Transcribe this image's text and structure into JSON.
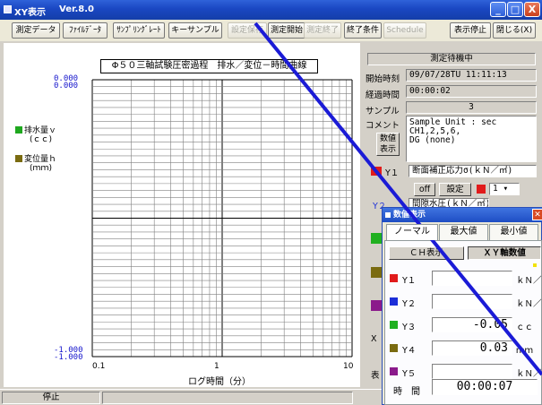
{
  "window": {
    "title": "XY表示",
    "version": "Ver.8.0",
    "btn_min": "_",
    "btn_max": "□",
    "btn_close": "X"
  },
  "toolbar": {
    "items": [
      {
        "label": "測定データ",
        "enabled": true
      },
      {
        "label": "ﾌｧｲﾙﾃﾞｰﾀ",
        "enabled": true
      },
      {
        "label": "ｻﾝﾌﾟﾘﾝｸﾞﾚｰﾄ",
        "enabled": true
      },
      {
        "label": "キーサンプル",
        "enabled": true
      },
      {
        "label": "設定保存",
        "enabled": false
      },
      {
        "label": "測定開始",
        "enabled": true
      },
      {
        "label": "測定終了",
        "enabled": false
      },
      {
        "label": "終了条件",
        "enabled": true
      },
      {
        "label": "Schedule",
        "enabled": false
      },
      {
        "label": "表示停止",
        "enabled": true
      },
      {
        "label": "閉じる(X)",
        "enabled": true
      }
    ]
  },
  "chart_data": {
    "type": "line",
    "title": "Φ５０三軸試験圧密過程　排水／変位－時間曲線",
    "xlabel": "ログ時間（分）",
    "x_scale": "log",
    "xlim": [
      0.1,
      10
    ],
    "x_tick_labels": [
      "0.1",
      "1",
      "10"
    ],
    "y_top_labels": [
      "0.000",
      "0.000"
    ],
    "y_bottom_labels": [
      "-1.000",
      "-1.000"
    ],
    "ylim": [
      -1,
      0
    ],
    "grid": true,
    "series": [
      {
        "name": "排水量ｖ",
        "unit": "(ｃｃ)",
        "color": "#1fa81f",
        "values": []
      },
      {
        "name": "変位量ｈ",
        "unit": "(ｍｍ)",
        "color": "#7a6b10",
        "values": []
      }
    ]
  },
  "panel": {
    "status": "測定待機中",
    "start_time_label": "開始時刻",
    "start_time": "09/07/28TU 11:11:13",
    "elapsed_label": "経過時間",
    "elapsed": "00:00:02",
    "sample_label": "サンプル",
    "sample": "3",
    "comment_label": "コメント",
    "comment_lines": [
      "Sample Unit : sec",
      "CH1,2,5,6,",
      "DG (none)"
    ],
    "numeric_button": "数値表示",
    "y1_label": "Y１",
    "y1_field": "断面補正応力σ(ｋＮ／㎡)",
    "off_button": "off",
    "settings_button": "設定",
    "y2_fragment": "Y２",
    "y2_fragment_text": "間隙水圧(ｋＮ／㎡)",
    "x_fragment": "X",
    "hyo_fragment": "表"
  },
  "popup": {
    "title": "数値表示",
    "tabs": [
      "ノーマル",
      "最大値",
      "最小値"
    ],
    "subtabs": [
      "ＣＨ表示",
      "ＸＹ軸数値"
    ],
    "rows": [
      {
        "label": "Y１",
        "value": "",
        "unit": "ｋＮ／ｍ",
        "color": "#e11b1b"
      },
      {
        "label": "Y２",
        "value": "",
        "unit": "ｋＮ／ｍ",
        "color": "#1c2ed8"
      },
      {
        "label": "Y３",
        "value": "-0.05",
        "unit": "ｃｃ",
        "color": "#20b020"
      },
      {
        "label": "Y４",
        "value": "0.03",
        "unit": "ｍｍ",
        "color": "#7a6b10"
      },
      {
        "label": "Y５",
        "value": "",
        "unit": "ｋＮ／ｍ",
        "color": "#8b1a8b"
      }
    ],
    "time_label": "時　間",
    "time_value": "00:00:07"
  },
  "statusbar": {
    "status": "停止"
  }
}
